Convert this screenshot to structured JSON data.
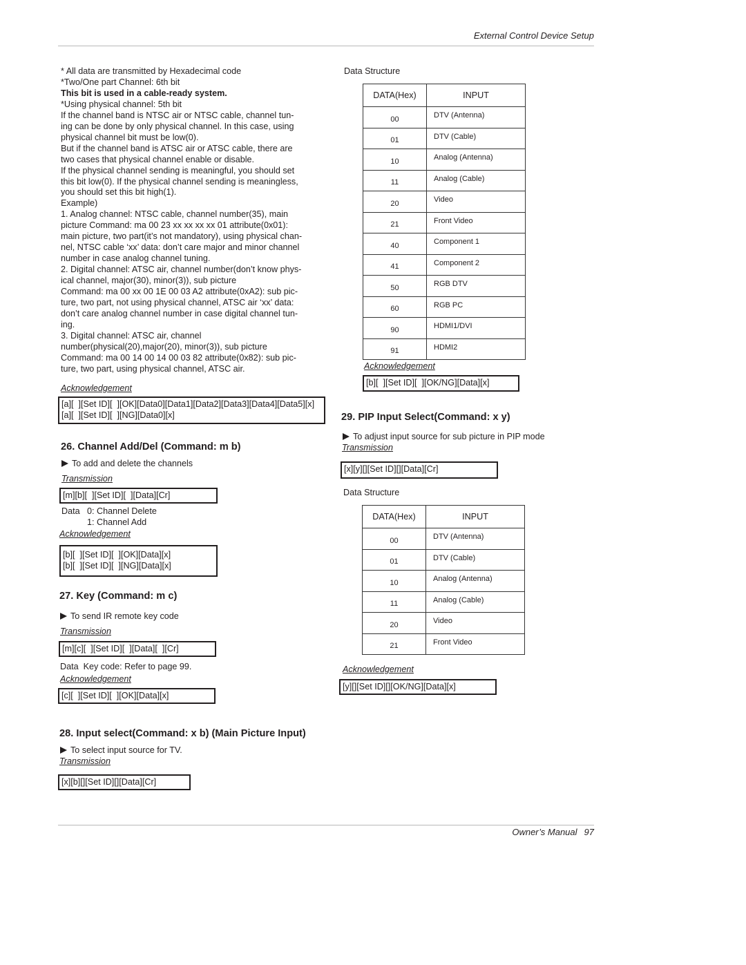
{
  "header": {
    "running_title": "External Control Device Setup"
  },
  "footer": {
    "manual": "Owner’s Manual",
    "page": "97"
  },
  "left": {
    "intro_lines": [
      "* All data are transmitted by Hexadecimal code",
      "*Two/One part Channel: 6th bit"
    ],
    "intro_bold": "This bit is used in a cable-ready system.",
    "notes_lines": [
      "*Using physical channel: 5th bit",
      "If the channel band is NTSC air or NTSC cable, channel tun-",
      "ing can be done by only physical channel. In this case, using",
      "physical channel bit must be low(0).",
      "But if the channel band is ATSC air or ATSC cable, there are",
      "two cases that physical channel enable or disable.",
      "If the physical channel sending is meaningful, you should set",
      "this bit low(0). If the physical channel sending is meaningless,",
      "you should set this bit high(1).",
      "Example)",
      "1. Analog channel: NTSC cable, channel number(35), main",
      "picture Command: ma 00 23 xx xx xx xx 01 attribute(0x01):",
      "main picture, two part(it’s not mandatory), using physical chan-",
      "nel, NTSC cable ‘xx’ data: don’t care major and minor channel",
      "number in case analog channel tuning.",
      "2. Digital channel: ATSC air, channel number(don’t know phys-",
      "ical channel, major(30), minor(3)), sub picture",
      "Command: ma 00 xx 00 1E 00 03 A2 attribute(0xA2): sub pic-",
      "ture, two part, not using physical channel, ATSC air ‘xx’ data:",
      "don’t care analog channel number in case digital channel tun-",
      "ing.",
      "3. Digital channel: ATSC air, channel",
      "number(physical(20),major(20), minor(3)), sub picture",
      "Command: ma 00 14 00 14 00 03 82 attribute(0x82): sub pic-",
      "ture, two part, using physical channel, ATSC air."
    ],
    "ack25": {
      "label": "Acknowledgement",
      "lines": [
        "[a][  ][Set ID][  ][OK][Data0][Data1][Data2][Data3][Data4][Data5][x]",
        "[a][  ][Set ID][  ][NG][Data0][x]"
      ]
    },
    "sec26": {
      "title": "26. Channel Add/Del (Command: m b)",
      "bullet": "To add and delete the channels",
      "transmission_label": "Transmission",
      "transmission": "[m][b][  ][Set ID][  ][Data][Cr]",
      "data_label": "Data",
      "data_values": [
        "0: Channel Delete",
        "1: Channel Add"
      ],
      "ack_label": "Acknowledgement",
      "ack_lines": [
        "[b][  ][Set ID][  ][OK][Data][x]",
        "[b][  ][Set ID][  ][NG][Data][x]"
      ]
    },
    "sec27": {
      "title": "27. Key (Command: m c)",
      "bullet": "To send IR remote key code",
      "transmission_label": "Transmission",
      "transmission": "[m][c][  ][Set ID][  ][Data][  ][Cr]",
      "data_note": "Data  Key code: Refer to page 99.",
      "ack_label": "Acknowledgement",
      "ack": "[c][  ][Set ID][  ][OK][Data][x]"
    },
    "sec28": {
      "title": "28. Input select(Command: x b) (Main Picture Input)",
      "bullet": "To select input source for TV.",
      "transmission_label": "Transmission",
      "transmission": "[x][b][][Set ID][][Data][Cr]"
    }
  },
  "right": {
    "ds1": {
      "label": "Data Structure",
      "headers": [
        "DATA(Hex)",
        "INPUT"
      ],
      "rows": [
        [
          "00",
          "DTV (Antenna)"
        ],
        [
          "01",
          "DTV (Cable)"
        ],
        [
          "10",
          "Analog (Antenna)"
        ],
        [
          "11",
          "Analog (Cable)"
        ],
        [
          "20",
          "Video"
        ],
        [
          "21",
          "Front Video"
        ],
        [
          "40",
          "Component 1"
        ],
        [
          "41",
          "Component 2"
        ],
        [
          "50",
          "RGB DTV"
        ],
        [
          "60",
          "RGB PC"
        ],
        [
          "90",
          "HDMI1/DVI"
        ],
        [
          "91",
          "HDMI2"
        ]
      ],
      "ack_label": "Acknowledgement",
      "ack": "[b][  ][Set ID][  ][OK/NG][Data][x]"
    },
    "sec29": {
      "title": "29. PIP Input Select(Command: x y)",
      "bullet": "To adjust input source for sub picture in PIP mode",
      "transmission_label": "Transmission",
      "transmission": "[x][y][][Set ID][][Data][Cr]",
      "ds_label": "Data Structure",
      "headers": [
        "DATA(Hex)",
        "INPUT"
      ],
      "rows": [
        [
          "00",
          "DTV (Antenna)"
        ],
        [
          "01",
          "DTV (Cable)"
        ],
        [
          "10",
          "Analog (Antenna)"
        ],
        [
          "11",
          "Analog (Cable)"
        ],
        [
          "20",
          "Video"
        ],
        [
          "21",
          "Front Video"
        ]
      ],
      "ack_label": "Acknowledgement",
      "ack": "[y][][Set ID][][OK/NG][Data][x]"
    }
  }
}
